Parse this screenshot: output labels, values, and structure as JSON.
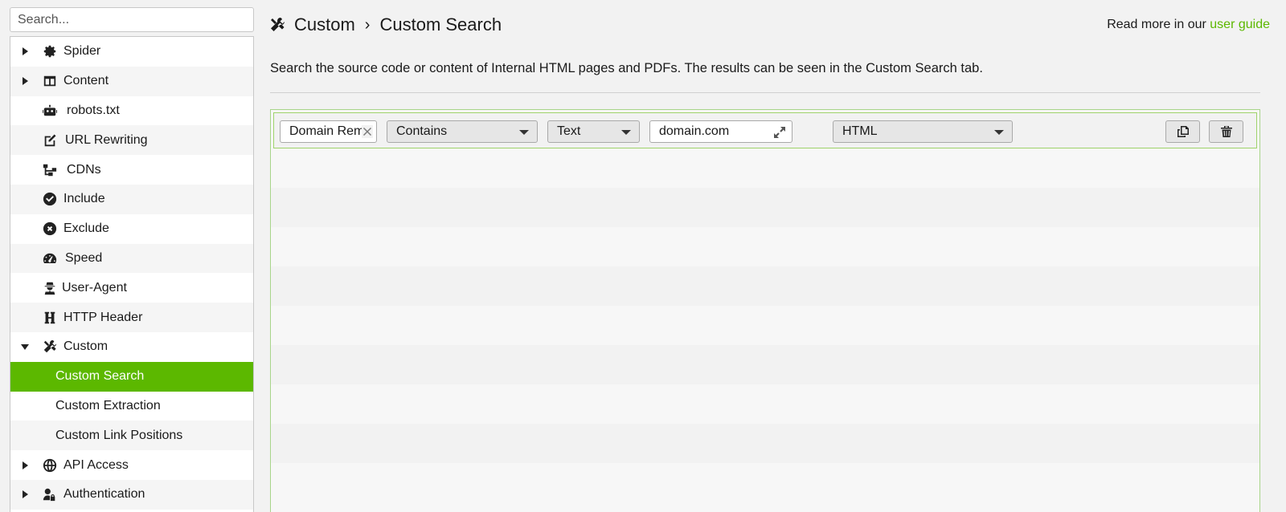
{
  "sidebar": {
    "search_placeholder": "Search...",
    "items": [
      {
        "label": "Spider",
        "icon": "gear-icon",
        "arrow": "collapsed"
      },
      {
        "label": "Content",
        "icon": "layout-icon",
        "arrow": "collapsed"
      },
      {
        "label": "robots.txt",
        "icon": "robot-icon",
        "arrow": "none"
      },
      {
        "label": "URL Rewriting",
        "icon": "edit-icon",
        "arrow": "none"
      },
      {
        "label": "CDNs",
        "icon": "network-icon",
        "arrow": "none"
      },
      {
        "label": "Include",
        "icon": "check-circle-icon",
        "arrow": "none"
      },
      {
        "label": "Exclude",
        "icon": "x-circle-icon",
        "arrow": "none"
      },
      {
        "label": "Speed",
        "icon": "speedometer-icon",
        "arrow": "none"
      },
      {
        "label": "User-Agent",
        "icon": "user-secret-icon",
        "arrow": "none"
      },
      {
        "label": "HTTP Header",
        "icon": "heading-icon",
        "arrow": "none"
      },
      {
        "label": "Custom",
        "icon": "tools-icon",
        "arrow": "expanded"
      },
      {
        "label": "Custom Search",
        "selected": true
      },
      {
        "label": "Custom Extraction"
      },
      {
        "label": "Custom Link Positions"
      },
      {
        "label": "API Access",
        "icon": "globe-icon",
        "arrow": "collapsed"
      },
      {
        "label": "Authentication",
        "icon": "user-lock-icon",
        "arrow": "collapsed"
      }
    ]
  },
  "header": {
    "crumb_parent": "Custom",
    "separator": "›",
    "crumb_current": "Custom Search",
    "guide_prefix": "Read more in our",
    "guide_link": "user guide"
  },
  "description": "Search the source code or content of Internal HTML pages and PDFs. The results can be seen in the Custom Search tab.",
  "filter": {
    "name_value": "Domain Rem",
    "operator_value": "Contains",
    "type_value": "Text",
    "query_value": "domain.com",
    "scope_value": "HTML"
  },
  "colors": {
    "accent": "#5cb800",
    "panel_border": "#a8d58a"
  }
}
